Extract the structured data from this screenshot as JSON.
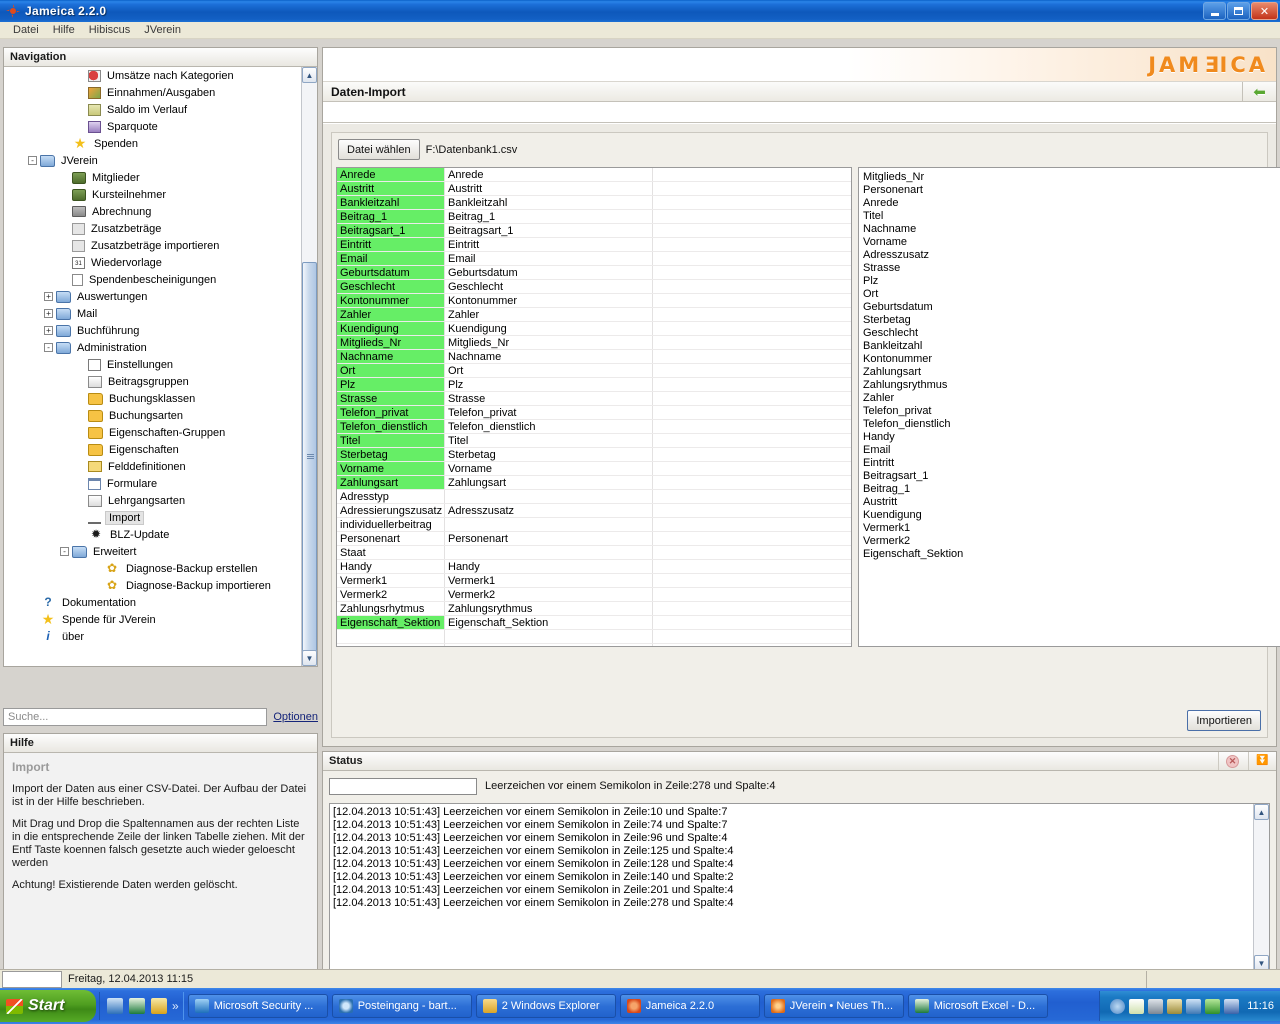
{
  "window": {
    "title": "Jameica 2.2.0",
    "icon": "jameica-leaf-icon",
    "buttons": {
      "minimize": "Minimieren",
      "maximize": "Maximieren",
      "close": "Schliessen"
    }
  },
  "menubar": {
    "items": [
      "Datei",
      "Hilfe",
      "Hibiscus",
      "JVerein"
    ]
  },
  "navigation": {
    "title": "Navigation",
    "items": [
      {
        "label": "Umsätze nach Kategorien",
        "indent": 4,
        "icon": "pie-chart-icon",
        "toggle": "",
        "selected": false
      },
      {
        "label": "Einnahmen/Ausgaben",
        "indent": 4,
        "icon": "income-expense-icon",
        "toggle": "",
        "selected": false
      },
      {
        "label": "Saldo im Verlauf",
        "indent": 4,
        "icon": "saldo-icon",
        "toggle": "",
        "selected": false
      },
      {
        "label": "Sparquote",
        "indent": 4,
        "icon": "sparquote-icon",
        "toggle": "",
        "selected": false
      },
      {
        "label": "Spenden",
        "indent": 3,
        "icon": "star-icon",
        "toggle": "",
        "selected": false
      },
      {
        "label": "JVerein",
        "indent": 1,
        "icon": "folder-blue-icon",
        "toggle": "-",
        "selected": false
      },
      {
        "label": "Mitglieder",
        "indent": 3,
        "icon": "members-icon",
        "toggle": "",
        "selected": false
      },
      {
        "label": "Kursteilnehmer",
        "indent": 3,
        "icon": "members-icon",
        "toggle": "",
        "selected": false
      },
      {
        "label": "Abrechnung",
        "indent": 3,
        "icon": "calculator-icon",
        "toggle": "",
        "selected": false
      },
      {
        "label": "Zusatzbeträge",
        "indent": 3,
        "icon": "pencil-icon",
        "toggle": "",
        "selected": false
      },
      {
        "label": "Zusatzbeträge importieren",
        "indent": 3,
        "icon": "pencil-icon",
        "toggle": "",
        "selected": false
      },
      {
        "label": "Wiedervorlage",
        "indent": 3,
        "icon": "calendar-icon",
        "toggle": "",
        "selected": false
      },
      {
        "label": "Spendenbescheinigungen",
        "indent": 3,
        "icon": "document-icon",
        "toggle": "",
        "selected": false
      },
      {
        "label": "Auswertungen",
        "indent": 2,
        "icon": "folder-blue-icon",
        "toggle": "+",
        "selected": false
      },
      {
        "label": "Mail",
        "indent": 2,
        "icon": "folder-blue-icon",
        "toggle": "+",
        "selected": false
      },
      {
        "label": "Buchführung",
        "indent": 2,
        "icon": "folder-blue-icon",
        "toggle": "+",
        "selected": false
      },
      {
        "label": "Administration",
        "indent": 2,
        "icon": "folder-blue-icon",
        "toggle": "-",
        "selected": false
      },
      {
        "label": "Einstellungen",
        "indent": 4,
        "icon": "settings-icon",
        "toggle": "",
        "selected": false
      },
      {
        "label": "Beitragsgruppen",
        "indent": 4,
        "icon": "beitragsgruppen-icon",
        "toggle": "",
        "selected": false
      },
      {
        "label": "Buchungsklassen",
        "indent": 4,
        "icon": "folder-yellow-icon",
        "toggle": "",
        "selected": false
      },
      {
        "label": "Buchungsarten",
        "indent": 4,
        "icon": "folder-yellow-icon",
        "toggle": "",
        "selected": false
      },
      {
        "label": "Eigenschaften-Gruppen",
        "indent": 4,
        "icon": "folder-yellow-icon",
        "toggle": "",
        "selected": false
      },
      {
        "label": "Eigenschaften",
        "indent": 4,
        "icon": "folder-yellow-icon",
        "toggle": "",
        "selected": false
      },
      {
        "label": "Felddefinitionen",
        "indent": 4,
        "icon": "list-icon",
        "toggle": "",
        "selected": false
      },
      {
        "label": "Formulare",
        "indent": 4,
        "icon": "form-icon",
        "toggle": "",
        "selected": false
      },
      {
        "label": "Lehrgangsarten",
        "indent": 4,
        "icon": "presentation-icon",
        "toggle": "",
        "selected": false
      },
      {
        "label": "Import",
        "indent": 4,
        "icon": "import-icon",
        "toggle": "",
        "selected": true
      },
      {
        "label": "BLZ-Update",
        "indent": 4,
        "icon": "eagle-icon",
        "toggle": "",
        "selected": false
      },
      {
        "label": "Erweitert",
        "indent": 3,
        "icon": "folder-blue-icon",
        "toggle": "-",
        "selected": false
      },
      {
        "label": "Diagnose-Backup erstellen",
        "indent": 5,
        "icon": "gear-export-icon",
        "toggle": "",
        "selected": false
      },
      {
        "label": "Diagnose-Backup importieren",
        "indent": 5,
        "icon": "gear-import-icon",
        "toggle": "",
        "selected": false
      },
      {
        "label": "Dokumentation",
        "indent": 1,
        "icon": "help-icon",
        "toggle": "",
        "selected": false
      },
      {
        "label": "Spende für JVerein",
        "indent": 1,
        "icon": "star-icon",
        "toggle": "",
        "selected": false
      },
      {
        "label": "über",
        "indent": 1,
        "icon": "info-icon",
        "toggle": "",
        "selected": false
      }
    ]
  },
  "search": {
    "placeholder": "Suche...",
    "value": "",
    "options_label": "Optionen"
  },
  "help": {
    "title": "Hilfe",
    "subtitle": "Import",
    "paragraphs": [
      "Import der Daten aus einer CSV-Datei. Der Aufbau der Datei ist in der Hilfe beschrieben.",
      "Mit Drag und Drop die Spaltennamen aus der rechten Liste in die entsprechende Zeile der linken Tabelle ziehen. Mit der Entf Taste koennen falsch gesetzte auch wieder geloescht werden",
      "Achtung! Existierende Daten werden gelöscht."
    ]
  },
  "main": {
    "logo": "JAMEICA",
    "view_title": "Daten-Import",
    "back_icon": "back-arrow-icon",
    "file_button": "Datei wählen",
    "file_path": "F:\\Datenbank1.csv",
    "import_button": "Importieren",
    "mapping_rows": [
      {
        "csv": "Anrede",
        "mapped": "Anrede",
        "matched": true
      },
      {
        "csv": "Austritt",
        "mapped": "Austritt",
        "matched": true
      },
      {
        "csv": "Bankleitzahl",
        "mapped": "Bankleitzahl",
        "matched": true
      },
      {
        "csv": "Beitrag_1",
        "mapped": "Beitrag_1",
        "matched": true
      },
      {
        "csv": "Beitragsart_1",
        "mapped": "Beitragsart_1",
        "matched": true
      },
      {
        "csv": "Eintritt",
        "mapped": "Eintritt",
        "matched": true
      },
      {
        "csv": "Email",
        "mapped": "Email",
        "matched": true
      },
      {
        "csv": "Geburtsdatum",
        "mapped": "Geburtsdatum",
        "matched": true
      },
      {
        "csv": "Geschlecht",
        "mapped": "Geschlecht",
        "matched": true
      },
      {
        "csv": "Kontonummer",
        "mapped": "Kontonummer",
        "matched": true
      },
      {
        "csv": "Zahler",
        "mapped": "Zahler",
        "matched": true
      },
      {
        "csv": "Kuendigung",
        "mapped": "Kuendigung",
        "matched": true
      },
      {
        "csv": "Mitglieds_Nr",
        "mapped": "Mitglieds_Nr",
        "matched": true
      },
      {
        "csv": "Nachname",
        "mapped": "Nachname",
        "matched": true
      },
      {
        "csv": "Ort",
        "mapped": "Ort",
        "matched": true
      },
      {
        "csv": "Plz",
        "mapped": "Plz",
        "matched": true
      },
      {
        "csv": "Strasse",
        "mapped": "Strasse",
        "matched": true
      },
      {
        "csv": "Telefon_privat",
        "mapped": "Telefon_privat",
        "matched": true
      },
      {
        "csv": "Telefon_dienstlich",
        "mapped": "Telefon_dienstlich",
        "matched": true
      },
      {
        "csv": "Titel",
        "mapped": "Titel",
        "matched": true
      },
      {
        "csv": "Sterbetag",
        "mapped": "Sterbetag",
        "matched": true
      },
      {
        "csv": "Vorname",
        "mapped": "Vorname",
        "matched": true
      },
      {
        "csv": "Zahlungsart",
        "mapped": "Zahlungsart",
        "matched": true
      },
      {
        "csv": "Adresstyp",
        "mapped": "",
        "matched": false
      },
      {
        "csv": "Adressierungszusatz",
        "mapped": "Adresszusatz",
        "matched": false
      },
      {
        "csv": "individuellerbeitrag",
        "mapped": "",
        "matched": false
      },
      {
        "csv": "Personenart",
        "mapped": "Personenart",
        "matched": false
      },
      {
        "csv": "Staat",
        "mapped": "",
        "matched": false
      },
      {
        "csv": "Handy",
        "mapped": "Handy",
        "matched": false
      },
      {
        "csv": "Vermerk1",
        "mapped": "Vermerk1",
        "matched": false
      },
      {
        "csv": "Vermerk2",
        "mapped": "Vermerk2",
        "matched": false
      },
      {
        "csv": "Zahlungsrhytmus",
        "mapped": "Zahlungsrythmus",
        "matched": false
      },
      {
        "csv": "Eigenschaft_Sektion",
        "mapped": "Eigenschaft_Sektion",
        "matched": true
      },
      {
        "csv": "",
        "mapped": "",
        "matched": false
      },
      {
        "csv": "",
        "mapped": "",
        "matched": false
      },
      {
        "csv": "",
        "mapped": "",
        "matched": false
      },
      {
        "csv": "",
        "mapped": "",
        "matched": false
      },
      {
        "csv": "",
        "mapped": "",
        "matched": false
      }
    ],
    "field_list": [
      "Mitglieds_Nr",
      "Personenart",
      "Anrede",
      "Titel",
      "Nachname",
      "Vorname",
      "Adresszusatz",
      "Strasse",
      "Plz",
      "Ort",
      "Geburtsdatum",
      "Sterbetag",
      "Geschlecht",
      "Bankleitzahl",
      "Kontonummer",
      "Zahlungsart",
      "Zahlungsrythmus",
      "Zahler",
      "Telefon_privat",
      "Telefon_dienstlich",
      "Handy",
      "Email",
      "Eintritt",
      "Beitragsart_1",
      "Beitrag_1",
      "Austritt",
      "Kuendigung",
      "Vermerk1",
      "Vermerk2",
      "Eigenschaft_Sektion"
    ]
  },
  "status": {
    "title": "Status",
    "clear_icon": "cancel-icon",
    "scroll_icon": "scroll-to-bottom-icon",
    "progress_value": "",
    "message": "Leerzeichen vor einem Semikolon in Zeile:278 und Spalte:4",
    "log": [
      "[12.04.2013 10:51:43] Leerzeichen vor einem Semikolon in Zeile:10 und Spalte:7",
      "[12.04.2013 10:51:43] Leerzeichen vor einem Semikolon in Zeile:74 und Spalte:7",
      "[12.04.2013 10:51:43] Leerzeichen vor einem Semikolon in Zeile:96 und Spalte:4",
      "[12.04.2013 10:51:43] Leerzeichen vor einem Semikolon in Zeile:125 und Spalte:4",
      "[12.04.2013 10:51:43] Leerzeichen vor einem Semikolon in Zeile:128 und Spalte:4",
      "[12.04.2013 10:51:43] Leerzeichen vor einem Semikolon in Zeile:140 und Spalte:2",
      "[12.04.2013 10:51:43] Leerzeichen vor einem Semikolon in Zeile:201 und Spalte:4",
      "[12.04.2013 10:51:43] Leerzeichen vor einem Semikolon in Zeile:278 und Spalte:4"
    ]
  },
  "appstatus": {
    "text": "Freitag, 12.04.2013 11:15"
  },
  "taskbar": {
    "start_label": "Start",
    "quicklaunch": [
      "ie-icon",
      "excel-icon",
      "notes-icon"
    ],
    "quicklaunch_more": "»",
    "tasks": [
      {
        "label": "Microsoft Security ...",
        "icon": "security-icon"
      },
      {
        "label": "Posteingang - bart...",
        "icon": "outlook-icon"
      },
      {
        "label": "2 Windows Explorer",
        "icon": "folder-icon"
      },
      {
        "label": "Jameica 2.2.0",
        "icon": "jameica-leaf-icon"
      },
      {
        "label": "JVerein • Neues Th...",
        "icon": "firefox-icon"
      },
      {
        "label": "Microsoft Excel - D...",
        "icon": "excel-icon"
      }
    ],
    "tray_icons": [
      "show-hidden-icon",
      "mail-icon",
      "isdn-icon",
      "bug-icon",
      "network-icon",
      "update-icon",
      "monitor-icon"
    ],
    "clock": "11:16"
  },
  "colors": {
    "accent": "#f08a1d",
    "match_green": "#66ee66",
    "titlebar_blue": "#1c6fd8",
    "link": "#16257a"
  }
}
